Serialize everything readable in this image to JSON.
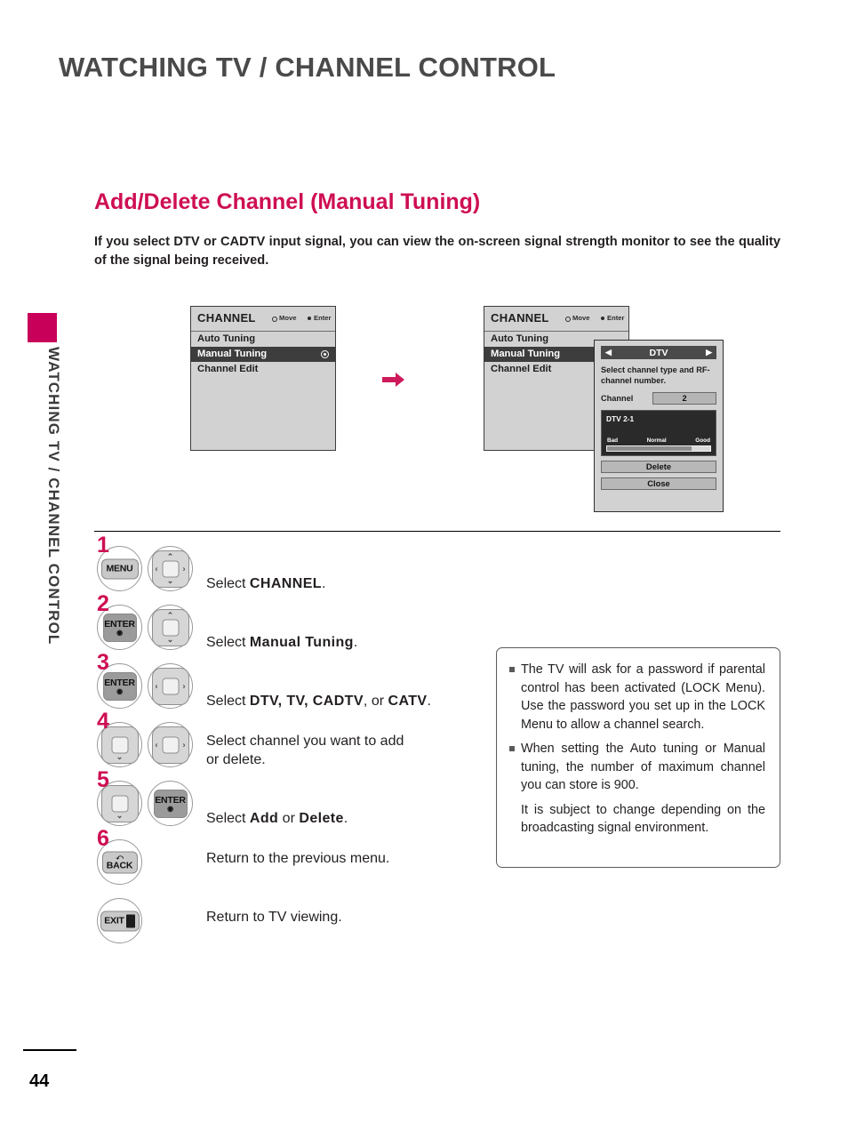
{
  "page": {
    "title": "WATCHING TV / CHANNEL CONTROL",
    "side_rail_text": "WATCHING TV / CHANNEL CONTROL",
    "number": "44",
    "accent_color": "#ce0e53"
  },
  "section": {
    "heading": "Add/Delete Channel (Manual Tuning)",
    "intro": "If you select DTV or CADTV input signal, you can view the on-screen signal strength monitor to see the quality of the signal being received."
  },
  "osd": {
    "title": "CHANNEL",
    "hint_move": "Move",
    "hint_enter": "Enter",
    "items": [
      {
        "label": "Auto Tuning",
        "selected": false
      },
      {
        "label": "Manual Tuning",
        "selected": true
      },
      {
        "label": "Channel Edit",
        "selected": false
      }
    ]
  },
  "dtv_dialog": {
    "title": "DTV",
    "arrow_left": "◀",
    "arrow_right": "▶",
    "description": "Select channel type and RF-channel number.",
    "channel_label": "Channel",
    "channel_value": "2",
    "signal": {
      "name": "DTV 2-1",
      "scale": [
        "Bad",
        "Normal",
        "Good"
      ],
      "level_percent": 82
    },
    "buttons": [
      {
        "label": "Delete"
      },
      {
        "label": "Close"
      }
    ]
  },
  "steps": [
    {
      "num": "1",
      "keys": [
        "menu",
        "dpad-4way"
      ],
      "text_plain": "Select ",
      "text_bold": "CHANNEL",
      "text_tail": "."
    },
    {
      "num": "2",
      "keys": [
        "enter",
        "dpad-updown"
      ],
      "text_plain": "Select ",
      "text_bold": "Manual Tuning",
      "text_tail": "."
    },
    {
      "num": "3",
      "keys": [
        "enter",
        "dpad-leftright"
      ],
      "text_plain": "Select ",
      "text_bold": "DTV, TV, CADTV",
      "text_mid": ", or ",
      "text_bold2": "CATV",
      "text_tail": "."
    },
    {
      "num": "4",
      "keys": [
        "dpad-down",
        "dpad-leftright"
      ],
      "text_plain": "Select channel you want to add\nor delete.",
      "text_bold": "",
      "text_tail": ""
    },
    {
      "num": "5",
      "keys": [
        "dpad-down",
        "enter"
      ],
      "text_plain": "Select ",
      "text_bold": "Add",
      "text_mid": " or ",
      "text_bold2": "Delete",
      "text_tail": "."
    },
    {
      "num": "6",
      "keys": [
        "back"
      ],
      "text_plain": "Return to the previous menu.",
      "text_bold": "",
      "text_tail": ""
    },
    {
      "num": "",
      "keys": [
        "exit"
      ],
      "text_plain": "Return to TV viewing.",
      "text_bold": "",
      "text_tail": ""
    }
  ],
  "key_labels": {
    "menu": "MENU",
    "enter": "ENTER",
    "back": "BACK",
    "exit": "EXIT"
  },
  "note": {
    "items": [
      "The TV will ask for a password if parental control has been activated (LOCK Menu). Use the password you set up in the LOCK Menu to allow a channel search.",
      "When setting the Auto tuning or Manual tuning, the number of maximum channel you can store is 900."
    ],
    "sub": "It is subject to change depending on the broadcasting signal environment."
  }
}
